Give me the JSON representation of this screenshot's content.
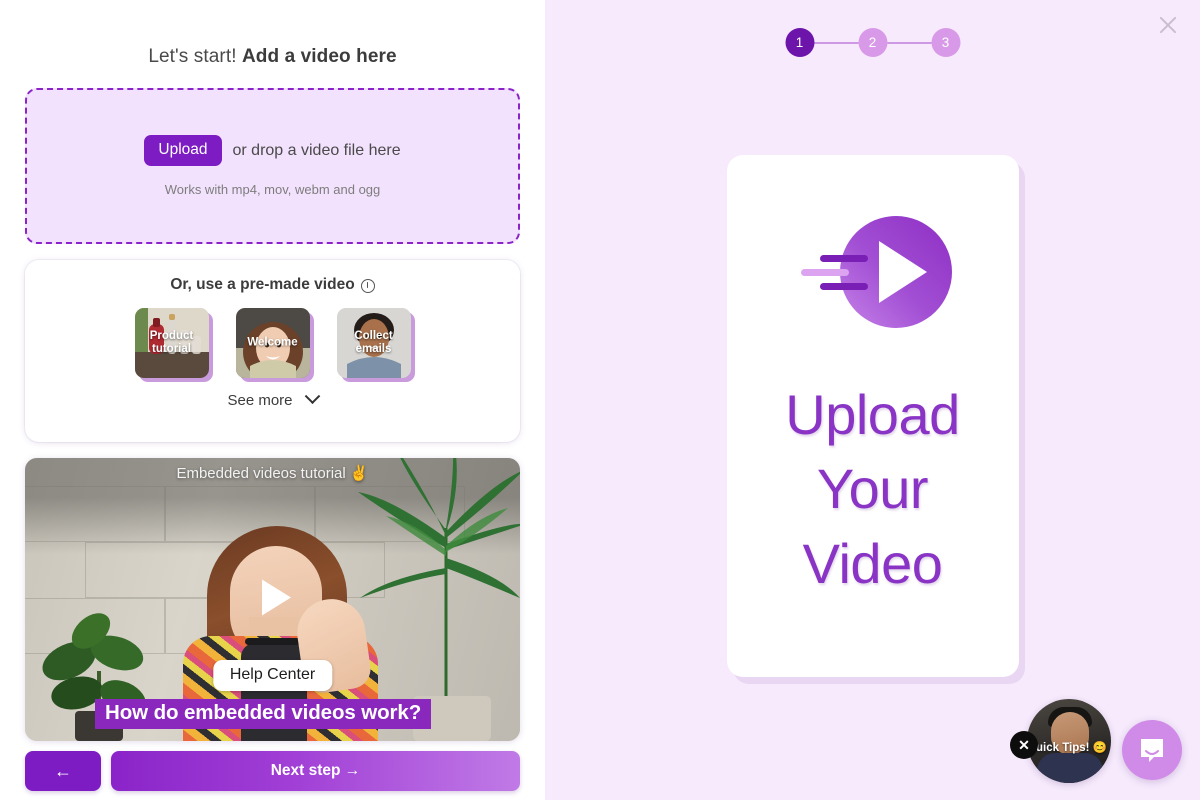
{
  "left": {
    "title_normal": "Let's start! ",
    "title_strong": "Add a video here",
    "dropzone": {
      "upload_label": "Upload",
      "drop_text": "or drop a video file here",
      "formats_text": "Works with mp4, mov, webm and ogg"
    },
    "premade": {
      "title": "Or, use a pre-made video",
      "help_icon": "help-circle-icon",
      "thumbnails": [
        {
          "label": "Product tutorial"
        },
        {
          "label": "Welcome"
        },
        {
          "label": "Collect emails"
        }
      ],
      "see_more_label": "See more",
      "see_more_icon": "chevron-down-icon"
    },
    "tutorial_video": {
      "top_title": "Embedded videos tutorial ✌️",
      "chip_label": "Help Center",
      "caption": "How do embedded videos work?",
      "play_icon": "play-icon"
    },
    "footer": {
      "back_label": "←",
      "next_label": "Next step →"
    }
  },
  "right": {
    "close_icon": "close-icon",
    "steps": [
      {
        "number": "1",
        "state": "active"
      },
      {
        "number": "2",
        "state": "idle"
      },
      {
        "number": "3",
        "state": "idle"
      }
    ],
    "card": {
      "icon": "video-play-circle-icon",
      "line1": "Upload",
      "line2": "Your",
      "line3": "Video"
    },
    "widgets": {
      "tips_label": "Quick Tips! 😊",
      "tips_close_icon": "close-icon",
      "chat_icon": "chat-bubble-icon"
    }
  },
  "colors": {
    "brand_purple": "#7c1cc2",
    "deep_purple": "#6d15ab",
    "light_purple": "#d89ae8",
    "panel_bg": "#f6eafc",
    "dropzone_bg": "#f3e2fd",
    "caption_purple": "#8a28bd",
    "title_purple": "#8a34c6"
  }
}
